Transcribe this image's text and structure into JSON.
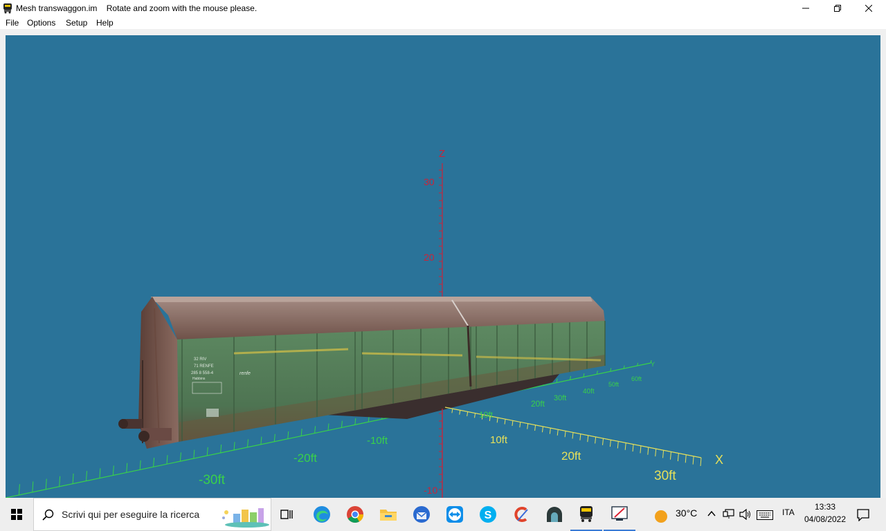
{
  "window": {
    "app_name": "Mesh transwaggon.im",
    "status_message": "Rotate and zoom with the mouse please."
  },
  "menu": {
    "items": [
      "File",
      "Options",
      "Setup",
      "Help"
    ]
  },
  "viewport": {
    "background": "#2a7399",
    "axis_z_label": "Z",
    "axis_x_label": "X",
    "axis_y_label": "Y",
    "z_ticks": [
      "30",
      "20",
      "-10"
    ],
    "x_ticks": [
      "10ft",
      "20ft",
      "30ft"
    ],
    "x_neg_ticks": [
      "-10ft",
      "-20ft",
      "-30ft"
    ],
    "y_ticks": [
      "10ft",
      "20ft",
      "30ft",
      "40ft",
      "50ft",
      "60ft"
    ],
    "colors": {
      "z_axis": "#c8243a",
      "x_axis": "#e6e05a",
      "y_axis": "#39d14a"
    }
  },
  "wagon": {
    "markings": [
      "32 RIV",
      "71 RENFE",
      "285 8 558-4",
      "Habbins"
    ],
    "logo": "renfe"
  },
  "taskbar": {
    "search_placeholder": "Scrivi qui per eseguire la ricerca",
    "weather": "30°C",
    "language": "ITA",
    "time": "13:33",
    "date": "04/08/2022"
  }
}
